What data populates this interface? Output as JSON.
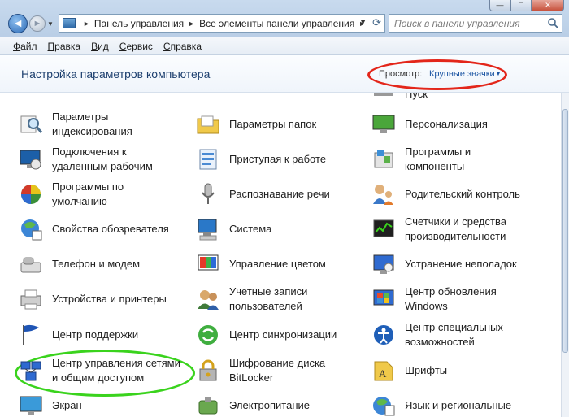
{
  "window": {
    "minimize_label": "—",
    "maximize_label": "□",
    "close_label": "✕"
  },
  "address": {
    "crumbs": [
      "Панель управления",
      "Все элементы панели управления"
    ]
  },
  "search": {
    "placeholder": "Поиск в панели управления"
  },
  "menu": [
    "Файл",
    "Правка",
    "Вид",
    "Сервис",
    "Справка"
  ],
  "header": {
    "title": "Настройка параметров компьютера",
    "view_label": "Просмотр:",
    "view_value": "Крупные значки"
  },
  "items": {
    "col1": [
      {
        "label": "Параметры\nиндексирования",
        "icon": "indexing-icon"
      },
      {
        "label": "Подключения к\nудаленным рабочим",
        "icon": "remote-desktop-icon"
      },
      {
        "label": "Программы по\nумолчанию",
        "icon": "default-programs-icon"
      },
      {
        "label": "Свойства обозревателя",
        "icon": "internet-options-icon"
      },
      {
        "label": "Телефон и модем",
        "icon": "phone-modem-icon"
      },
      {
        "label": "Устройства и принтеры",
        "icon": "printers-icon"
      },
      {
        "label": "Центр поддержки",
        "icon": "action-center-flag-icon"
      },
      {
        "label": "Центр управления сетями\nи общим доступом",
        "icon": "network-center-icon"
      },
      {
        "label": "Экран",
        "icon": "display-icon"
      }
    ],
    "col2": [
      {
        "label": "Параметры папок",
        "icon": "folder-options-icon"
      },
      {
        "label": "Приступая к работе",
        "icon": "getting-started-icon"
      },
      {
        "label": "Распознавание речи",
        "icon": "microphone-icon"
      },
      {
        "label": "Система",
        "icon": "system-icon"
      },
      {
        "label": "Управление цветом",
        "icon": "color-management-icon"
      },
      {
        "label": "Учетные записи\nпользователей",
        "icon": "user-accounts-icon"
      },
      {
        "label": "Центр синхронизации",
        "icon": "sync-center-icon"
      },
      {
        "label": "Шифрование диска\nBitLocker",
        "icon": "bitlocker-icon"
      },
      {
        "label": "Электропитание",
        "icon": "power-options-icon"
      }
    ],
    "col3": [
      {
        "label": "Пуск",
        "icon": "start-icon"
      },
      {
        "label": "Персонализация",
        "icon": "personalization-icon"
      },
      {
        "label": "Программы и\nкомпоненты",
        "icon": "programs-features-icon"
      },
      {
        "label": "Родительский контроль",
        "icon": "parental-controls-icon"
      },
      {
        "label": "Счетчики и средства\nпроизводительности",
        "icon": "performance-icon"
      },
      {
        "label": "Устранение неполадок",
        "icon": "troubleshooting-icon"
      },
      {
        "label": "Центр обновления\nWindows",
        "icon": "windows-update-icon"
      },
      {
        "label": "Центр специальных\nвозможностей",
        "icon": "ease-of-access-icon"
      },
      {
        "label": "Шрифты",
        "icon": "fonts-icon"
      },
      {
        "label": "Язык и региональные",
        "icon": "region-language-icon"
      }
    ]
  },
  "colors": {
    "highlight_view": "#e3261a",
    "highlight_network": "#3ad31d",
    "link_blue": "#1d56a3"
  }
}
